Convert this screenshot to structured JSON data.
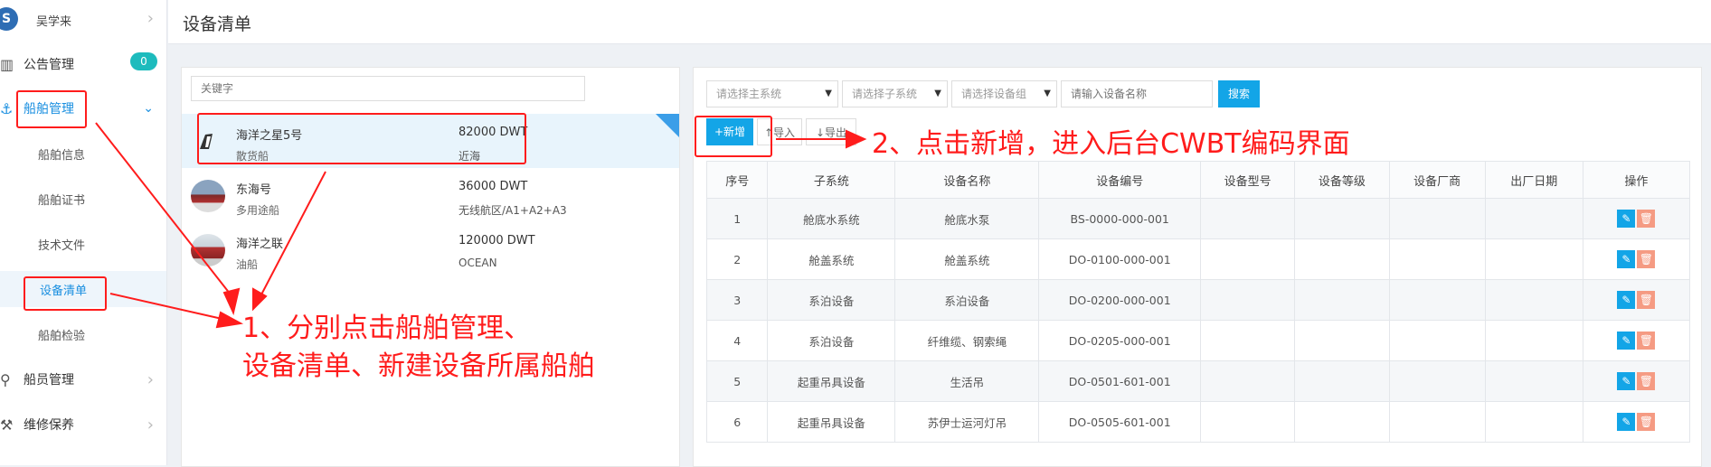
{
  "header": {
    "title": "设备清单"
  },
  "sidebar": {
    "user_name": "吴学来",
    "logo_text": "S",
    "items": [
      {
        "label": "公告管理",
        "icon": "book-icon",
        "badge": "0"
      },
      {
        "label": "船舶管理",
        "icon": "anchor-icon"
      },
      {
        "label": "船员管理",
        "icon": "user-icon"
      },
      {
        "label": "维修保养",
        "icon": "wrench-icon"
      }
    ],
    "sub_items": [
      {
        "label": "船舶信息"
      },
      {
        "label": "船舶证书"
      },
      {
        "label": "技术文件"
      },
      {
        "label": "设备清单",
        "active": true
      },
      {
        "label": "船舶检验"
      }
    ]
  },
  "ship_panel": {
    "search_placeholder": "关键字",
    "ships": [
      {
        "name": "海洋之星5号",
        "type": "散货船",
        "dwt": "82000 DWT",
        "area": "近海",
        "selected": true
      },
      {
        "name": "东海号",
        "type": "多用途船",
        "dwt": "36000 DWT",
        "area": "无线航区/A1+A2+A3"
      },
      {
        "name": "海洋之联",
        "type": "油船",
        "dwt": "120000 DWT",
        "area": "OCEAN"
      }
    ]
  },
  "equipment": {
    "filters": {
      "main_system": "请选择主系统",
      "sub_system": "请选择子系统",
      "group": "请选择设备组",
      "name_placeholder": "请输入设备名称"
    },
    "search_label": "搜索",
    "add_label": "+新增",
    "import_label": "↑导入",
    "export_label": "↓导出",
    "columns": [
      "序号",
      "子系统",
      "设备名称",
      "设备编号",
      "设备型号",
      "设备等级",
      "设备厂商",
      "出厂日期",
      "操作"
    ],
    "rows": [
      [
        "1",
        "舱底水系统",
        "舱底水泵",
        "BS-0000-000-001",
        "",
        "",
        "",
        ""
      ],
      [
        "2",
        "舱盖系统",
        "舱盖系统",
        "DO-0100-000-001",
        "",
        "",
        "",
        ""
      ],
      [
        "3",
        "系泊设备",
        "系泊设备",
        "DO-0200-000-001",
        "",
        "",
        "",
        ""
      ],
      [
        "4",
        "系泊设备",
        "纤维缆、钢索绳",
        "DO-0205-000-001",
        "",
        "",
        "",
        ""
      ],
      [
        "5",
        "起重吊具设备",
        "生活吊",
        "DO-0501-601-001",
        "",
        "",
        "",
        ""
      ],
      [
        "6",
        "起重吊具设备",
        "苏伊士运河灯吊",
        "DO-0505-601-001",
        "",
        "",
        "",
        ""
      ]
    ]
  },
  "annotations": {
    "note1_line1": "1、分别点击船舶管理、",
    "note1_line2": "设备清单、新建设备所属船舶",
    "note2": "2、点击新增，进入后台CWBT编码界面"
  },
  "colors": {
    "accent": "#13a5e7",
    "annotation": "#ff1c1c",
    "badge": "#1dbbbd",
    "delete": "#f59b83"
  }
}
